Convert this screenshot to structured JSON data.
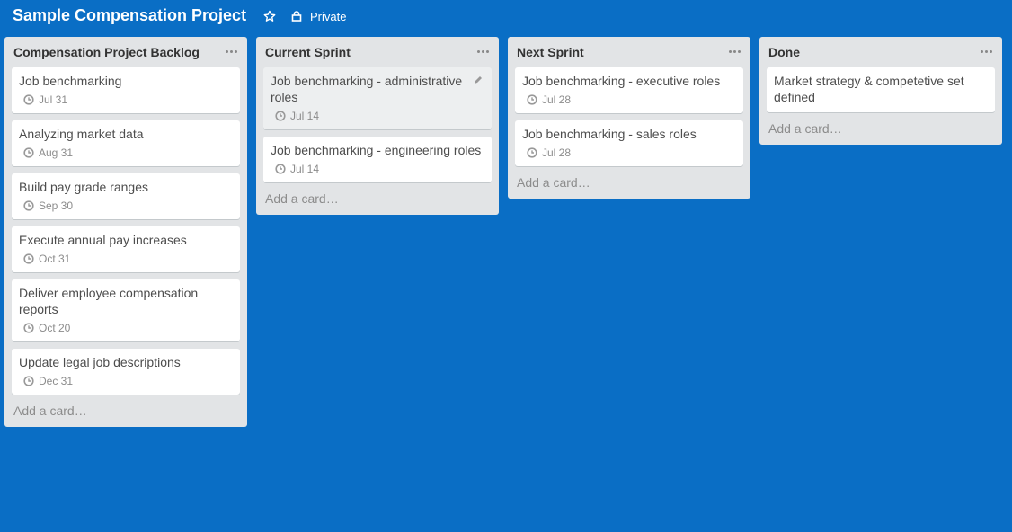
{
  "board": {
    "title": "Sample Compensation Project",
    "visibility": "Private"
  },
  "lists": [
    {
      "title": "Compensation Project Backlog",
      "add_card": "Add a card…",
      "cards": [
        {
          "title": "Job benchmarking",
          "due": "Jul 31"
        },
        {
          "title": "Analyzing market data",
          "due": "Aug 31"
        },
        {
          "title": "Build pay grade ranges",
          "due": "Sep 30"
        },
        {
          "title": "Execute annual pay increases",
          "due": "Oct 31"
        },
        {
          "title": "Deliver employee compensation reports",
          "due": "Oct 20"
        },
        {
          "title": "Update legal job descriptions",
          "due": "Dec 31"
        }
      ]
    },
    {
      "title": "Current Sprint",
      "add_card": "Add a card…",
      "cards": [
        {
          "title": "Job benchmarking - administrative roles",
          "due": "Jul 14"
        },
        {
          "title": "Job benchmarking - engineering roles",
          "due": "Jul 14"
        }
      ]
    },
    {
      "title": "Next Sprint",
      "add_card": "Add a card…",
      "cards": [
        {
          "title": "Job benchmarking - executive roles",
          "due": "Jul 28"
        },
        {
          "title": "Job benchmarking - sales roles",
          "due": "Jul 28"
        }
      ]
    },
    {
      "title": "Done",
      "add_card": "Add a card…",
      "cards": [
        {
          "title": "Market strategy & competetive set defined"
        }
      ]
    }
  ],
  "colors": {
    "board_background": "#0a6ec5",
    "list_background": "#e2e4e6",
    "card_background": "#ffffff"
  }
}
